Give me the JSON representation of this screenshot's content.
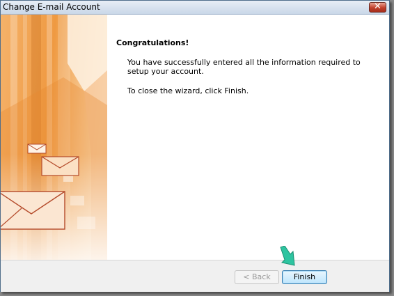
{
  "window": {
    "title": "Change E-mail Account",
    "close_glyph": "✕"
  },
  "content": {
    "heading": "Congratulations!",
    "message1": "You have successfully entered all the information required to setup your account.",
    "message2": "To close the wizard, click Finish."
  },
  "buttons": {
    "back_label": "< Back",
    "finish_label": "Finish"
  },
  "colors": {
    "accent_orange": "#f0a048",
    "arrow_green": "#2ec4a0"
  },
  "icons": [
    "envelope-icon",
    "close-icon",
    "pointer-arrow-icon"
  ]
}
